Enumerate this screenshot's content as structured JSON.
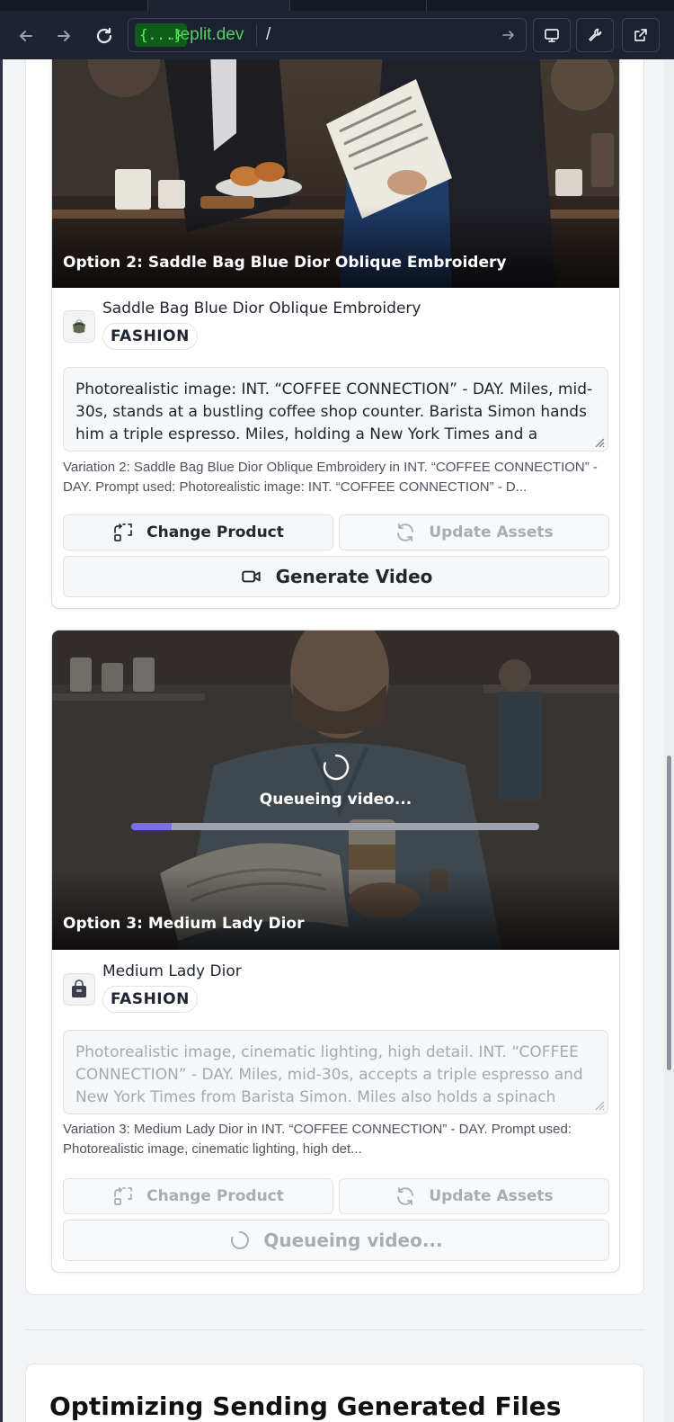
{
  "browser": {
    "url_chip": "{...}",
    "url_host": ".replit.dev",
    "url_path": "/"
  },
  "options": [
    {
      "caption": "Option 2: Saddle Bag Blue Dior Oblique Embroidery",
      "product_name": "Saddle Bag Blue Dior Oblique Embroidery",
      "category": "FASHION",
      "prompt": "Photorealistic image: INT. “COFFEE CONNECTION” - DAY. Miles, mid-30s, stands at a bustling coffee shop counter. Barista Simon hands him a triple espresso. Miles, holding a New York Times and a",
      "variation": "Variation 2: Saddle Bag Blue Dior Oblique Embroidery in INT. “COFFEE CONNECTION” - DAY. Prompt used: Photorealistic image: INT. “COFFEE CONNECTION” - D...",
      "change_product": "Change Product",
      "update_assets": "Update Assets",
      "primary_action": "Generate Video"
    },
    {
      "caption": "Option 3: Medium Lady Dior",
      "product_name": "Medium Lady Dior",
      "category": "FASHION",
      "prompt": "Photorealistic image, cinematic lighting, high detail. INT. “COFFEE CONNECTION” - DAY. Miles, mid-30s, accepts a triple espresso and New York Times from Barista Simon.  Miles also holds a spinach",
      "variation": "Variation 3: Medium Lady Dior in INT. “COFFEE CONNECTION” - DAY. Prompt used: Photorealistic image, cinematic lighting, high det...",
      "change_product": "Change Product",
      "update_assets": "Update Assets",
      "primary_action": "Queueing video...",
      "overlay_status": "Queueing video...",
      "progress": 0.1
    }
  ],
  "next_section_title": "Optimizing Sending Generated Files",
  "colors": {
    "accent": "#7c6cf0",
    "url_green": "#50d45c",
    "chrome_bg": "#1d2331"
  }
}
